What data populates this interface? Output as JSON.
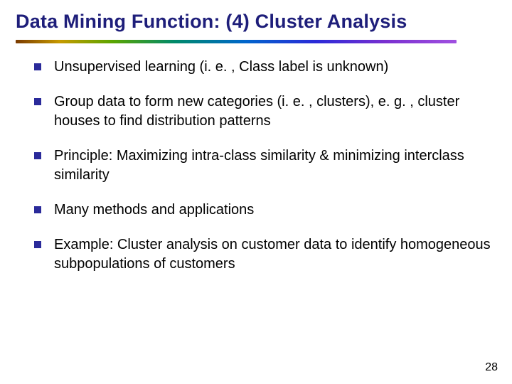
{
  "title": "Data Mining Function: (4) Cluster Analysis",
  "bullets": [
    "Unsupervised learning (i. e. , Class label is unknown)",
    "Group data to form new categories (i. e. , clusters), e. g. , cluster houses to find distribution patterns",
    "Principle: Maximizing intra-class similarity & minimizing interclass similarity",
    "Many methods and applications",
    "Example: Cluster analysis on customer data to identify homogeneous subpopulations of customers"
  ],
  "page_number": "28"
}
